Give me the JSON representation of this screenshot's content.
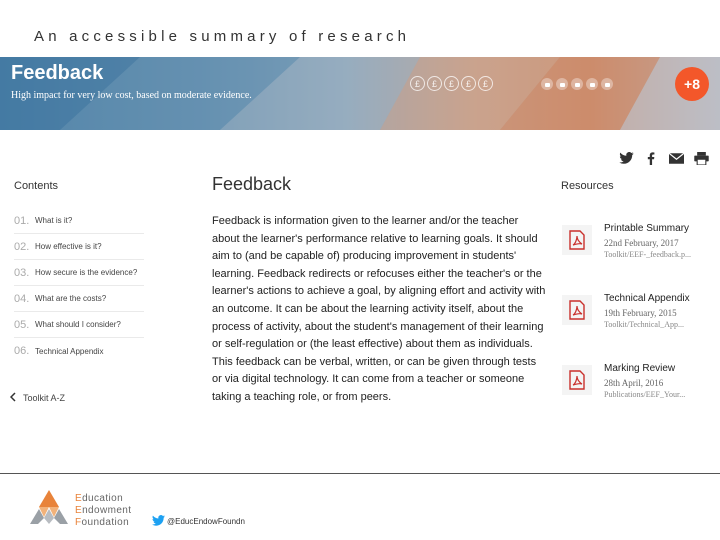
{
  "tagline": "An accessible summary of research",
  "banner": {
    "title": "Feedback",
    "subtitle": "High impact for very low cost, based on moderate evidence.",
    "money": [
      "£",
      "£",
      "£",
      "£",
      "£"
    ],
    "impact": "+8"
  },
  "contents": {
    "heading": "Contents",
    "items": [
      {
        "num": "01.",
        "label": "What is it?"
      },
      {
        "num": "02.",
        "label": "How effective is it?"
      },
      {
        "num": "03.",
        "label": "How secure is the evidence?"
      },
      {
        "num": "04.",
        "label": "What are the costs?"
      },
      {
        "num": "05.",
        "label": "What should I consider?"
      },
      {
        "num": "06.",
        "label": "Technical Appendix"
      }
    ],
    "toolkit_link": "Toolkit A-Z"
  },
  "main": {
    "heading": "Feedback",
    "body": "Feedback is information given to the learner and/or the teacher about the learner's performance relative to learning goals. It should aim to (and be capable of) producing improvement in students' learning. Feedback redirects or refocuses either the teacher's or the learner's actions to achieve a goal, by aligning effort and activity with an outcome. It can be about the learning activity itself, about the process of activity, about the student's management of their learning or self-regulation or (the least effective) about them as individuals. This feedback can be verbal, written, or can be given through tests or via digital technology. It can come from a teacher or someone taking a teaching role, or from peers."
  },
  "resources": {
    "heading": "Resources",
    "items": [
      {
        "title": "Printable Summary",
        "date": "22nd February, 2017",
        "path": "Toolkit/EEF-_feedback.p..."
      },
      {
        "title": "Technical Appendix",
        "date": "19th February, 2015",
        "path": "Toolkit/Technical_App..."
      },
      {
        "title": "Marking Review",
        "date": "28th April, 2016",
        "path": "Publications/EEF_Your..."
      }
    ]
  },
  "footer": {
    "logo_lines": [
      {
        "cap": "E",
        "rest": "ducation"
      },
      {
        "cap": "E",
        "rest": "ndowment"
      },
      {
        "cap": "F",
        "rest": "oundation"
      }
    ],
    "twitter_handle": "@EducEndowFoundn"
  },
  "colors": {
    "impact_badge": "#f3572a",
    "logo_accent": "#e8833a",
    "pdf_icon": "#c9302c",
    "twitter": "#1da1f2"
  },
  "icons": [
    "twitter-icon",
    "facebook-icon",
    "email-icon",
    "print-icon",
    "pdf-icon",
    "lock-icon",
    "pound-icon",
    "chevron-left-icon"
  ]
}
